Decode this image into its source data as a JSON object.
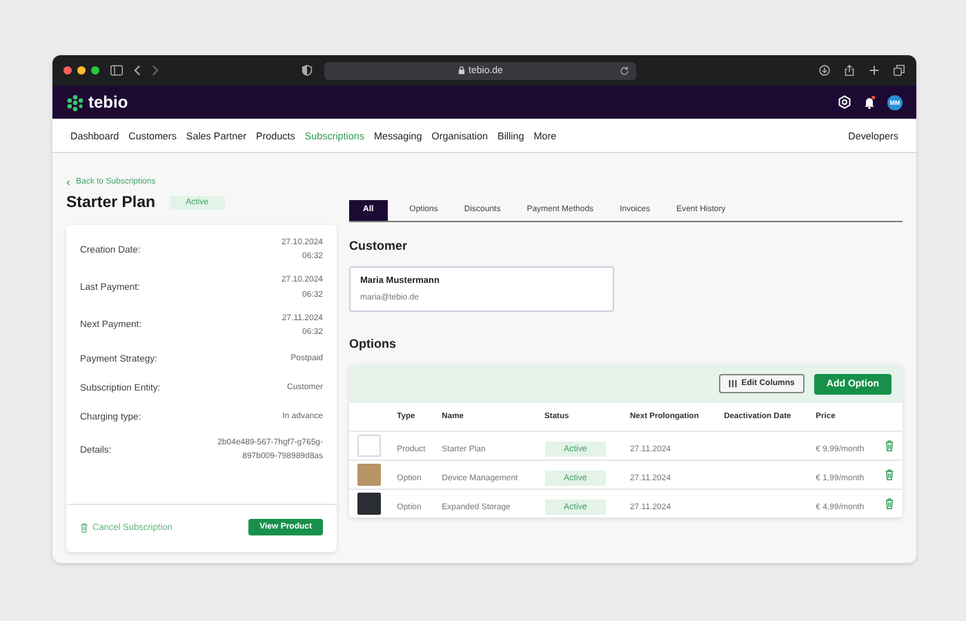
{
  "browser": {
    "url": "tebio.de"
  },
  "app": {
    "logo": "tebio",
    "avatar": "MM"
  },
  "nav": {
    "items": [
      {
        "label": "Dashboard",
        "selected": false
      },
      {
        "label": "Customers",
        "selected": false
      },
      {
        "label": "Sales Partner",
        "selected": false
      },
      {
        "label": "Products",
        "selected": false
      },
      {
        "label": "Subscriptions",
        "selected": true
      },
      {
        "label": "Messaging",
        "selected": false
      },
      {
        "label": "Organisation",
        "selected": false
      },
      {
        "label": "Billing",
        "selected": false
      },
      {
        "label": "More",
        "selected": false
      }
    ],
    "right": "Developers"
  },
  "back_link": "Back to Subscriptions",
  "title": "Starter Plan",
  "status": "Active",
  "details": [
    {
      "label": "Creation Date:",
      "value": "27.10.2024\n06:32"
    },
    {
      "label": "Last Payment:",
      "value": "27.10.2024\n06:32"
    },
    {
      "label": "Next Payment:",
      "value": "27.11.2024\n06:32"
    },
    {
      "label": "Payment Strategy:",
      "value": "Postpaid"
    },
    {
      "label": "Subscription Entity:",
      "value": "Customer"
    },
    {
      "label": "Charging type:",
      "value": "In advance"
    },
    {
      "label": "Details:",
      "value": "2b04e489-567-7hgf7-g765g-\n897b009-798989d8as"
    }
  ],
  "cancel_link": "Cancel Subscription",
  "view_button": "View Product",
  "tabs": [
    {
      "label": "All",
      "selected": true
    },
    {
      "label": "Options",
      "selected": false
    },
    {
      "label": "Discounts",
      "selected": false
    },
    {
      "label": "Payment Methods",
      "selected": false
    },
    {
      "label": "Invoices",
      "selected": false
    },
    {
      "label": "Event History",
      "selected": false
    }
  ],
  "customer": {
    "heading": "Customer",
    "name": "Maria Mustermann",
    "email": "maria@tebio.de"
  },
  "options": {
    "heading": "Options",
    "edit_button": "Edit Columns",
    "add_button": "Add Option",
    "columns": [
      "Type",
      "Name",
      "Status",
      "Next Prolongation",
      "Deactivation Date",
      "Price"
    ],
    "rows": [
      {
        "kind": "logo",
        "type": "Product",
        "name": "Starter Plan",
        "status": "Active",
        "next": "27.11.2024",
        "price": "€ 9,99/month"
      },
      {
        "kind": "photo",
        "type": "Option",
        "name": "Device Management",
        "status": "Active",
        "next": "27.11.2024",
        "price": "€ 1,99/month"
      },
      {
        "kind": "dark",
        "type": "Option",
        "name": "Expanded Storage",
        "status": "Active",
        "next": "27.11.2024",
        "price": "€ 4,99/month"
      }
    ]
  }
}
